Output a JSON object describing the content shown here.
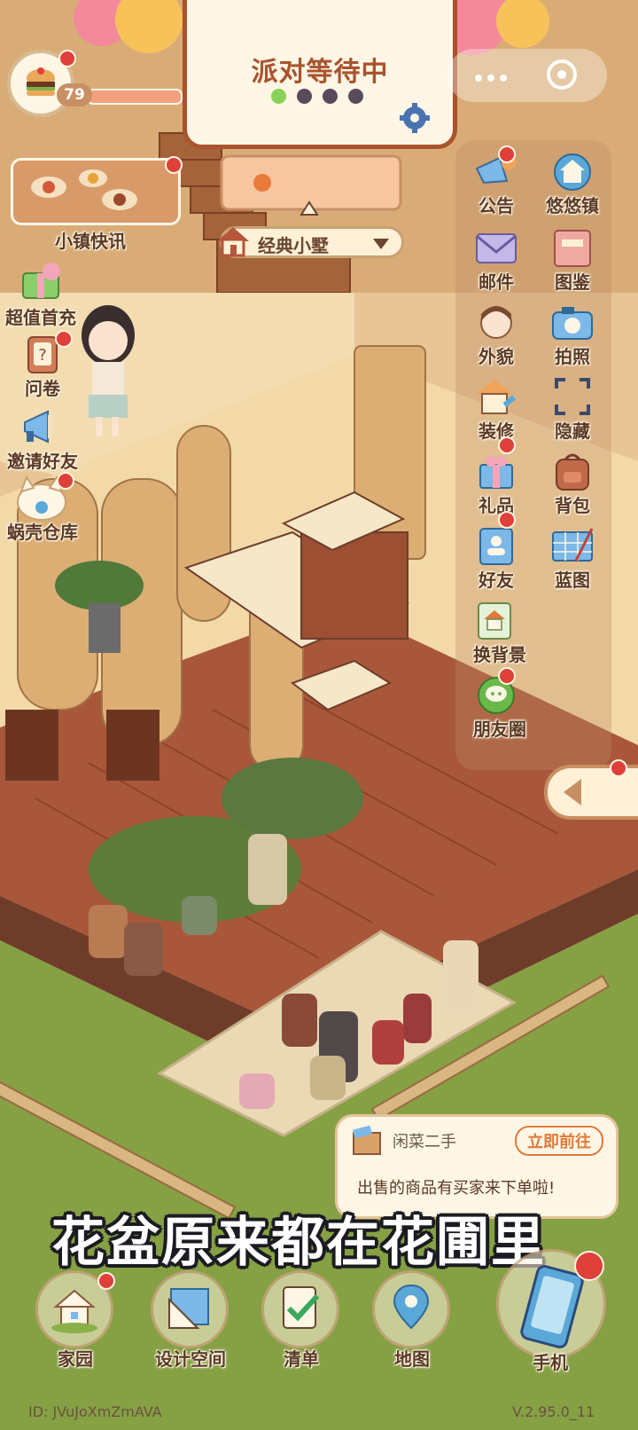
{
  "player": {
    "level": "79"
  },
  "party": {
    "title": "派对等待中",
    "dots": [
      "on",
      "off",
      "off",
      "off"
    ]
  },
  "house": {
    "name": "经典小墅"
  },
  "left_menu": [
    {
      "key": "news",
      "label": "小镇快讯",
      "icon": "news-thumbnail-icon"
    },
    {
      "key": "recharge",
      "label": "超值首充",
      "icon": "gift-box-icon"
    },
    {
      "key": "survey",
      "label": "问卷",
      "icon": "questionnaire-icon"
    },
    {
      "key": "invite",
      "label": "邀请好友",
      "icon": "megaphone-icon"
    },
    {
      "key": "storage",
      "label": "蜗壳仓库",
      "icon": "cat-storage-icon"
    }
  ],
  "right_menu": [
    {
      "key": "notice",
      "label": "公告",
      "icon": "announcement-icon"
    },
    {
      "key": "town",
      "label": "悠悠镇",
      "icon": "town-house-icon"
    },
    {
      "key": "mail",
      "label": "邮件",
      "icon": "mail-icon"
    },
    {
      "key": "album",
      "label": "图鉴",
      "icon": "album-icon"
    },
    {
      "key": "look",
      "label": "外貌",
      "icon": "appearance-icon"
    },
    {
      "key": "photo",
      "label": "拍照",
      "icon": "camera-icon"
    },
    {
      "key": "decorate",
      "label": "装修",
      "icon": "decorate-icon"
    },
    {
      "key": "hide",
      "label": "隐藏",
      "icon": "hide-frame-icon"
    },
    {
      "key": "gift",
      "label": "礼品",
      "icon": "gift-icon"
    },
    {
      "key": "bag",
      "label": "背包",
      "icon": "backpack-icon"
    },
    {
      "key": "friends",
      "label": "好友",
      "icon": "friends-book-icon"
    },
    {
      "key": "blueprint",
      "label": "蓝图",
      "icon": "blueprint-icon"
    },
    {
      "key": "background",
      "label": "换背景",
      "icon": "change-background-icon"
    },
    {
      "key": "moments",
      "label": "朋友圈",
      "icon": "moments-icon"
    }
  ],
  "notification": {
    "source": "闲菜二手",
    "action": "立即前往",
    "message": "出售的商品有买家来下单啦!"
  },
  "caption": "花盆原来都在花圃里",
  "bottom_nav": [
    {
      "key": "home",
      "label": "家园",
      "icon": "home-icon"
    },
    {
      "key": "design",
      "label": "设计空间",
      "icon": "design-ruler-icon"
    },
    {
      "key": "list",
      "label": "清单",
      "icon": "checklist-icon"
    },
    {
      "key": "map",
      "label": "地图",
      "icon": "map-pin-icon"
    },
    {
      "key": "phone",
      "label": "手机",
      "icon": "phone-icon"
    }
  ],
  "footer": {
    "id": "ID: JVuJoXmZmAVA",
    "version": "V.2.95.0_11"
  },
  "colors": {
    "accent": "#a8542e",
    "badge": "#e0403a",
    "dot_on": "#8ad15a",
    "dot_off": "#5a4a5c"
  }
}
